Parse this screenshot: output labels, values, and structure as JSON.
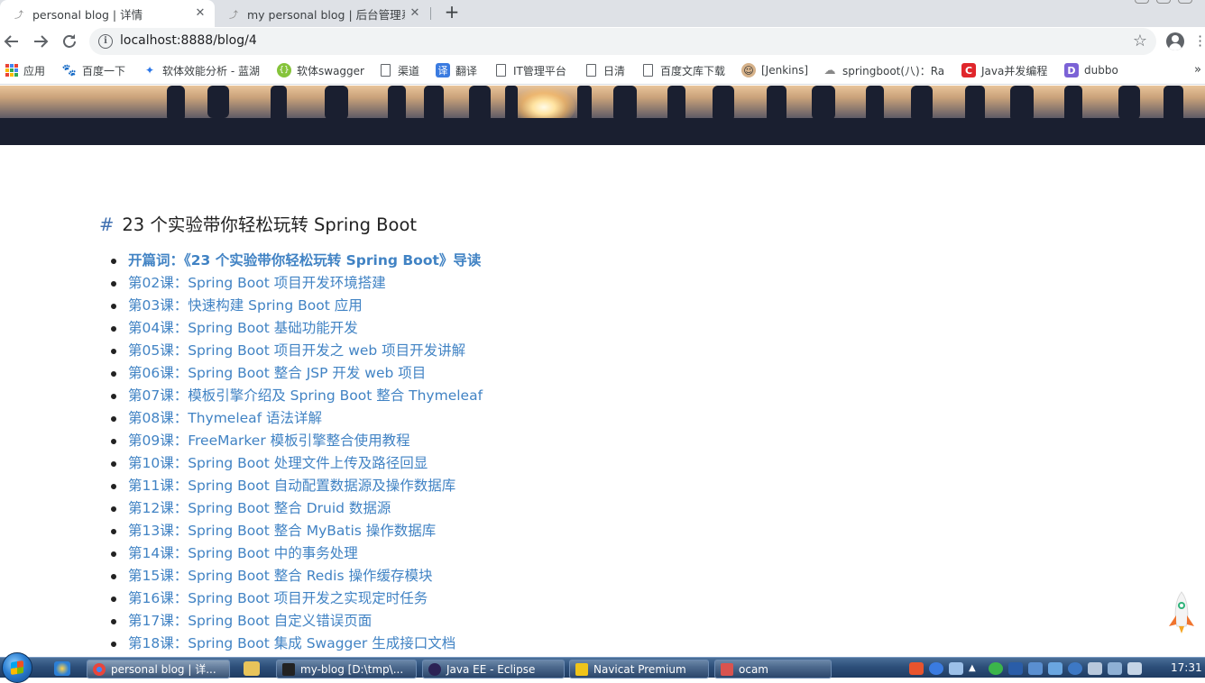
{
  "tabs": [
    {
      "title": "personal blog | 详情",
      "active": true
    },
    {
      "title": "my personal blog | 后台管理系",
      "active": false
    }
  ],
  "toolbar": {
    "url_host": "localhost",
    "url_path": ":8888/blog/4"
  },
  "bookmarks": [
    {
      "label": "应用",
      "icon": "apps-grid-icon"
    },
    {
      "label": "百度一下",
      "icon": "baidu-paw-icon"
    },
    {
      "label": "软体效能分析 - 蓝湖",
      "icon": "lanhu-icon"
    },
    {
      "label": "软体swagger",
      "icon": "swagger-icon"
    },
    {
      "label": "渠道",
      "icon": "page-icon"
    },
    {
      "label": "翻译",
      "icon": "translate-icon"
    },
    {
      "label": "IT管理平台",
      "icon": "page-icon"
    },
    {
      "label": "日清",
      "icon": "page-icon"
    },
    {
      "label": "百度文库下载",
      "icon": "page-icon"
    },
    {
      "label": "[Jenkins]",
      "icon": "jenkins-icon"
    },
    {
      "label": "springboot(八)：Ra",
      "icon": "springboot-icon"
    },
    {
      "label": "Java并发编程",
      "icon": "csdn-icon"
    },
    {
      "label": "dubbo",
      "icon": "dubbo-icon"
    }
  ],
  "bookmarks_more": "»",
  "article": {
    "hash": "#",
    "title": "23 个实验带你轻松玩转 Spring Boot",
    "lessons": [
      "开篇词：《23 个实验带你轻松玩转 Spring Boot》导读",
      "第02课：Spring Boot 项目开发环境搭建",
      "第03课：快速构建 Spring Boot 应用",
      "第04课：Spring Boot 基础功能开发",
      "第05课：Spring Boot 项目开发之 web 项目开发讲解",
      "第06课：Spring Boot 整合 JSP 开发 web 项目",
      "第07课：模板引擎介绍及 Spring Boot 整合 Thymeleaf",
      "第08课：Thymeleaf 语法详解",
      "第09课：FreeMarker 模板引擎整合使用教程",
      "第10课：Spring Boot 处理文件上传及路径回显",
      "第11课：Spring Boot 自动配置数据源及操作数据库",
      "第12课：Spring Boot 整合 Druid 数据源",
      "第13课：Spring Boot 整合 MyBatis 操作数据库",
      "第14课：Spring Boot 中的事务处理",
      "第15课：Spring Boot 整合 Redis 操作缓存模块",
      "第16课：Spring Boot 项目开发之实现定时任务",
      "第17课：Spring Boot 自定义错误页面",
      "第18课：Spring Boot 集成 Swagger 生成接口文档"
    ]
  },
  "taskbar": {
    "items": [
      {
        "label": "personal blog | 详...",
        "active": true,
        "color": "#e8453c"
      },
      {
        "label": "my-blog [D:\\tmp\\...",
        "active": false,
        "color": "#222222"
      },
      {
        "label": "Java EE - Eclipse",
        "active": false,
        "color": "#2c2255"
      },
      {
        "label": "Navicat Premium",
        "active": false,
        "color": "#f0c419"
      },
      {
        "label": "ocam",
        "active": false,
        "color": "#d9534f"
      }
    ],
    "clock": "17:31"
  },
  "colors": {
    "link": "#4183c4",
    "hash": "#3f6fb0",
    "tabstrip": "#dee1e6"
  }
}
